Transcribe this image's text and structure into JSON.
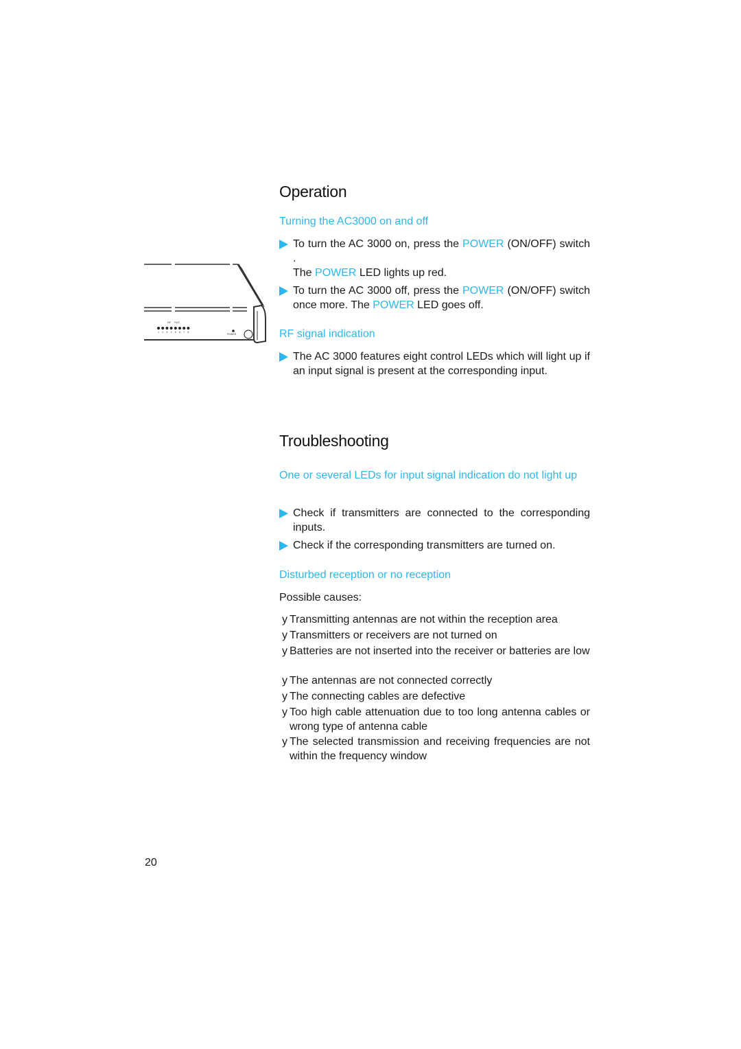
{
  "operation": {
    "title": "Operation",
    "turning": {
      "heading": "Turning the AC3000 on and off",
      "step1": {
        "a": "To turn the AC 3000 on, press the ",
        "power": "POWER",
        "b": " (ON/OFF) switch    .",
        "line2_a": "The ",
        "line2_power": "POWER",
        "line2_b": " LED     lights up red."
      },
      "step2": {
        "a": "To turn the AC 3000 off, press the ",
        "power": "POWER",
        "b": " (ON/OFF) switch     once more. The ",
        "power2": "POWER",
        "c": " LED     goes off."
      }
    },
    "rf": {
      "heading": "RF signal indication",
      "step": "The AC 3000 features eight control LEDs      which will light up if an input signal is present at the corresponding input."
    }
  },
  "device_illustration": {
    "label_rf": "RF",
    "label_put": "PUT",
    "led_numbers": [
      "1",
      "2",
      "3",
      "4",
      "5",
      "6",
      "7",
      "8"
    ],
    "label_power": "POWER"
  },
  "troubleshooting": {
    "title": "Troubleshooting",
    "leds": {
      "heading": "One or several LEDs for input signal indication      do not light up",
      "steps": [
        "Check if transmitters are connected to the corresponding inputs.",
        "Check if the corresponding transmitters are turned on."
      ]
    },
    "reception": {
      "heading": "Disturbed reception or no reception",
      "intro": "Possible causes:",
      "bullet_glyph": "y",
      "causes": [
        "Transmitting antennas are not within the reception area",
        "Transmitters or receivers are not turned on",
        "Batteries are not inserted into the receiver or batteries are low",
        "The antennas are not connected correctly",
        "The connecting cables are defective",
        "Too high cable attenuation due to too long antenna cables or wrong type of antenna cable",
        "The selected transmission and receiving frequencies are not within the frequency window"
      ]
    }
  },
  "page_number": "20",
  "colors": {
    "accent": "#2bb7ee",
    "text": "#1a1a1a"
  }
}
